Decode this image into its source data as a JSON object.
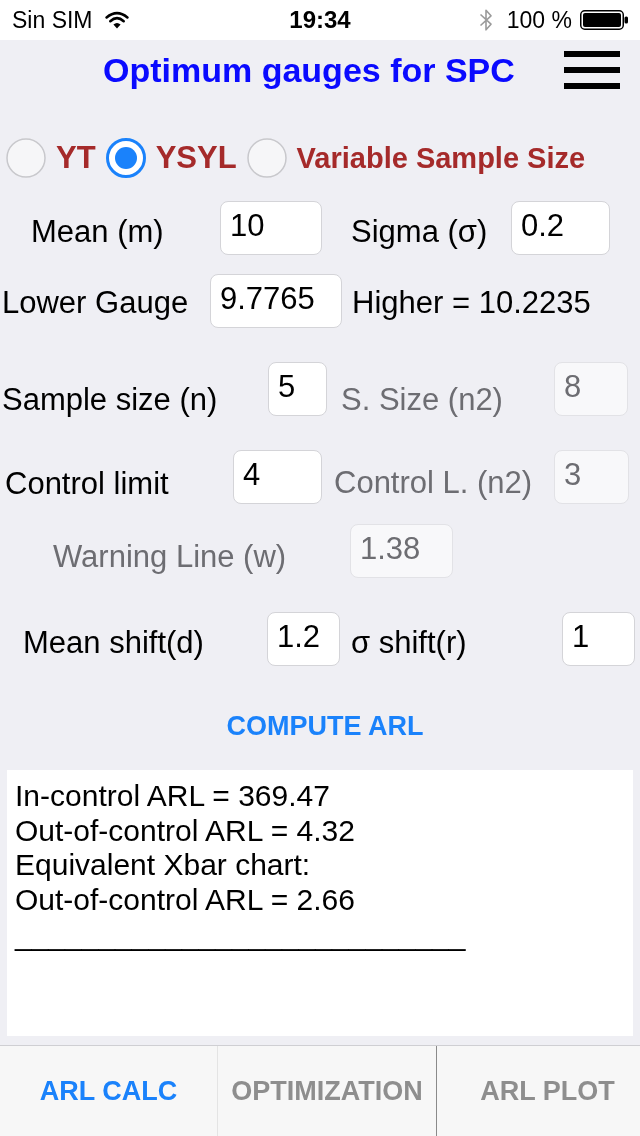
{
  "status_bar": {
    "carrier": "Sin SIM",
    "time": "19:34",
    "battery": "100 %"
  },
  "header": {
    "title": "Optimum gauges for SPC"
  },
  "chart_types": [
    {
      "label": "YT",
      "selected": false
    },
    {
      "label": "YSYL",
      "selected": true
    },
    {
      "label": "Variable Sample Size",
      "selected": false
    }
  ],
  "form": [
    {
      "items": [
        {
          "kind": "label",
          "text": "Mean (m)",
          "disabled": false
        },
        {
          "kind": "field",
          "value": "10",
          "disabled": false
        },
        {
          "kind": "label",
          "text": "Sigma (σ)",
          "disabled": false
        },
        {
          "kind": "field",
          "value": "0.2",
          "disabled": false
        }
      ]
    },
    {
      "items": [
        {
          "kind": "label",
          "text": "Lower Gauge",
          "disabled": false
        },
        {
          "kind": "field",
          "value": "9.7765",
          "disabled": false
        },
        {
          "kind": "label",
          "text": "Higher = 10.2235",
          "disabled": false
        }
      ]
    },
    {
      "items": [
        {
          "kind": "label",
          "text": "Sample size (n)",
          "disabled": false
        },
        {
          "kind": "field",
          "value": "5",
          "disabled": false
        },
        {
          "kind": "label",
          "text": "S. Size (n2)",
          "disabled": true
        },
        {
          "kind": "field",
          "value": "8",
          "disabled": true
        }
      ]
    },
    {
      "items": [
        {
          "kind": "label",
          "text": "Control limit",
          "disabled": false
        },
        {
          "kind": "field",
          "value": "4",
          "disabled": false
        },
        {
          "kind": "label",
          "text": "Control L. (n2)",
          "disabled": true
        },
        {
          "kind": "field",
          "value": "3",
          "disabled": true
        }
      ]
    },
    {
      "items": [
        {
          "kind": "label",
          "text": "Warning Line (w)",
          "disabled": true
        },
        {
          "kind": "field",
          "value": "1.38",
          "disabled": true
        }
      ]
    },
    {
      "items": [
        {
          "kind": "label",
          "text": "Mean shift(d)",
          "disabled": false
        },
        {
          "kind": "field",
          "value": "1.2",
          "disabled": false
        },
        {
          "kind": "label",
          "text": "σ shift(r)",
          "disabled": false
        },
        {
          "kind": "field",
          "value": "1",
          "disabled": false
        }
      ]
    }
  ],
  "compute_button": {
    "label": "COMPUTE ARL"
  },
  "results": {
    "lines": [
      "In-control ARL = 369.47",
      "Out-of-control ARL = 4.32",
      "Equivalent Xbar chart:",
      "Out-of-control ARL = 2.66",
      "___________________________"
    ]
  },
  "tabs": [
    {
      "label": "ARL CALC",
      "selected": true
    },
    {
      "label": "OPTIMIZATION",
      "selected": false
    },
    {
      "label": "ARL PLOT",
      "selected": false
    }
  ]
}
